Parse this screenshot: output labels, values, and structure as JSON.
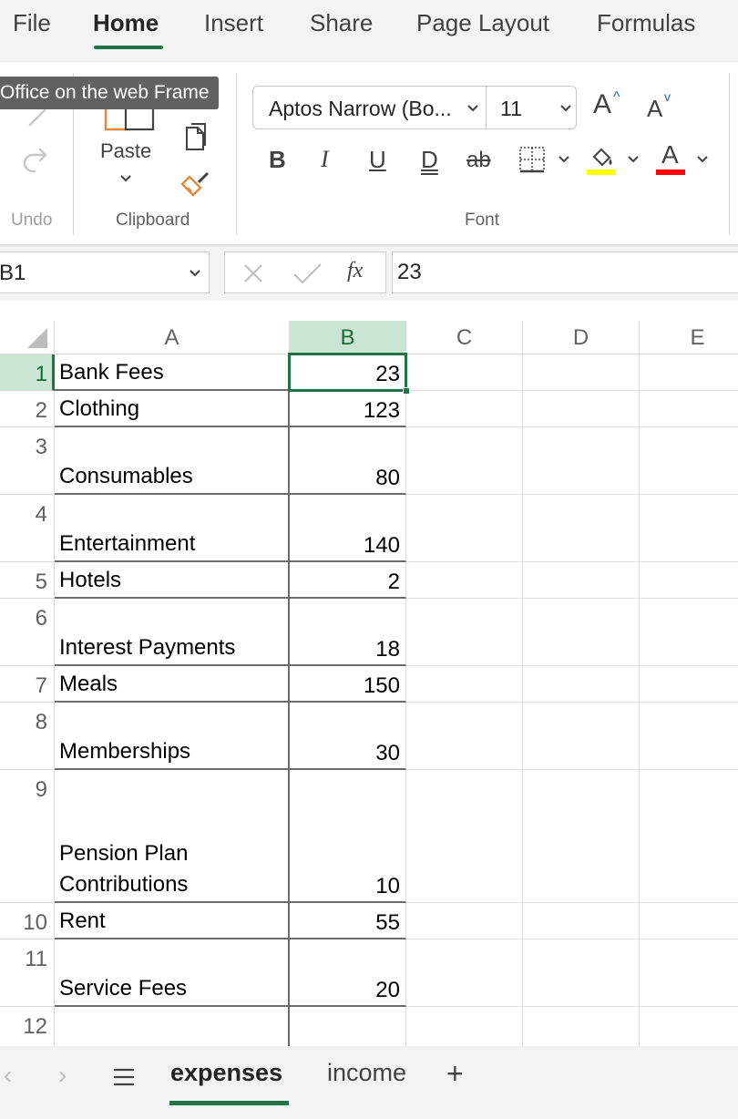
{
  "menu": {
    "tabs": [
      "File",
      "Home",
      "Insert",
      "Share",
      "Page Layout",
      "Formulas"
    ],
    "active": "Home"
  },
  "tooltip": "Office on the web Frame",
  "ribbon": {
    "undo_label": "Undo",
    "paste_label": "Paste",
    "clipboard_label": "Clipboard",
    "font_label": "Font",
    "font_name": "Aptos Narrow (Bo...",
    "font_size": "11",
    "bold": "B",
    "italic": "I",
    "underline": "U",
    "double_underline": "D",
    "strikethrough": "ab",
    "grow_font": "A",
    "shrink_font": "A",
    "font_color_glyph": "A",
    "fill_color": "#ffff00",
    "font_color": "#ff0000"
  },
  "formula_bar": {
    "name_box": "B1",
    "fx": "fx",
    "value": "23"
  },
  "grid": {
    "columns": [
      "A",
      "B",
      "C",
      "D",
      "E"
    ],
    "selected_column": "B",
    "selected_row": "1",
    "rows": [
      {
        "num": "1",
        "a": "Bank Fees",
        "b": "23"
      },
      {
        "num": "2",
        "a": "Clothing",
        "b": "123"
      },
      {
        "num": "3",
        "a": "Consumables",
        "b": "80"
      },
      {
        "num": "4",
        "a": "Entertainment",
        "b": "140"
      },
      {
        "num": "5",
        "a": "Hotels",
        "b": "2"
      },
      {
        "num": "6",
        "a": "Interest Payments",
        "b": "18"
      },
      {
        "num": "7",
        "a": "Meals",
        "b": "150"
      },
      {
        "num": "8",
        "a": "Memberships",
        "b": "30"
      },
      {
        "num": "9",
        "a": "Pension Plan\nContributions",
        "b": "10"
      },
      {
        "num": "10",
        "a": "Rent",
        "b": "55"
      },
      {
        "num": "11",
        "a": "Service Fees",
        "b": "20"
      },
      {
        "num": "12",
        "a": "",
        "b": ""
      }
    ]
  },
  "sheets": {
    "tabs": [
      "expenses",
      "income"
    ],
    "active": "expenses",
    "add": "+"
  },
  "colors": {
    "accent": "#217346",
    "selection_header": "#c9e6d4"
  }
}
